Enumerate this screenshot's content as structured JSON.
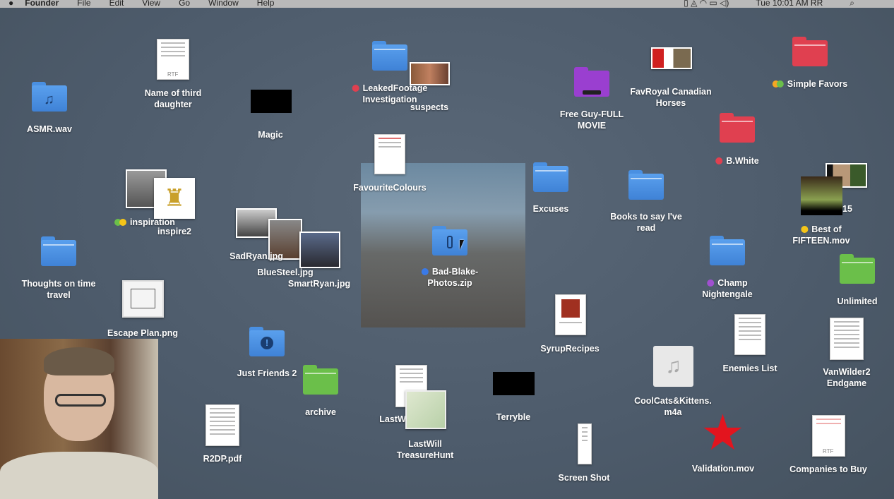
{
  "menubar": {
    "items": [
      "Founder",
      "File",
      "Edit",
      "View",
      "Go",
      "Window",
      "Help"
    ],
    "clock": "Tue 10:01 AM RR"
  },
  "desktop": {
    "asmr": "ASMR.wav",
    "third_daughter": [
      "Name of third",
      "daughter"
    ],
    "rtf_badge": "RTF",
    "magic": "Magic",
    "leaked": [
      "LeakedFootage",
      "Investigation"
    ],
    "suspects": "suspects",
    "favourite": "FavouriteColours",
    "freeguy": [
      "Free Guy-FULL",
      "MOVIE"
    ],
    "royal": [
      "FavRoyal Canadian",
      "Horses"
    ],
    "simple": "Simple Favors",
    "bwhite": "B.White",
    "fifteen_partial": "15",
    "fifteen": [
      "Best of",
      "FIFTEEN.mov"
    ],
    "excuses": "Excuses",
    "books": [
      "Books to say I've",
      "read"
    ],
    "champ": [
      "Champ",
      "Nightengale"
    ],
    "unlimited": "Unlimited",
    "inspiration": "inspiration",
    "inspire2": "inspire2",
    "thoughts": [
      "Thoughts on  time",
      "travel"
    ],
    "escape": "Escape Plan.png",
    "sadryan": "SadRyan.jpg",
    "bluesteel": "BlueSteel.jpg",
    "smartryan": "SmartRyan.jpg",
    "badblake": [
      "Bad-Blake-",
      "Photos.zip"
    ],
    "syrup": "SyrupRecipes",
    "enemies": "Enemies List",
    "vanwilder": [
      "VanWilder2",
      "Endgame"
    ],
    "coolcats": [
      "CoolCats&Kittens.",
      "m4a"
    ],
    "justfriends": "Just Friends 2",
    "archive": "archive",
    "lastw_partial": "LastW",
    "lastwill": [
      "LastWill",
      "TreasureHunt"
    ],
    "terryble": "Terryble",
    "r2dp": "R2DP.pdf",
    "screenshot": "Screen Shot",
    "validation": "Validation.mov",
    "companies": "Companies to Buy"
  },
  "colors": {
    "red": "#e04050",
    "blue": "#4a90e2",
    "green": "#6bbf4a",
    "yellow": "#f5c518",
    "orange": "#f5a623",
    "purple": "#a050d0"
  }
}
